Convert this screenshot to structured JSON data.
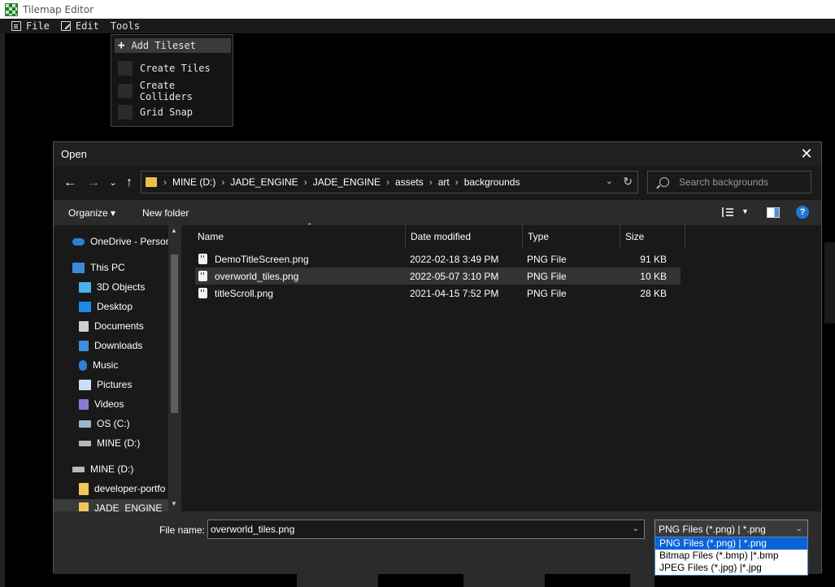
{
  "app": {
    "title": "Tilemap Editor"
  },
  "menubar": {
    "file": "File",
    "edit": "Edit",
    "tools": "Tools"
  },
  "tools_menu": {
    "items": [
      "Add Tileset",
      "Create Tiles",
      "Create Colliders",
      "Grid Snap"
    ],
    "plus_glyph": "+"
  },
  "dialog": {
    "title": "Open",
    "close_glyph": "✕",
    "nav": {
      "back": "←",
      "forward": "→",
      "recent": "⌄",
      "up": "↑"
    },
    "breadcrumb": [
      "MINE (D:)",
      "JADE_ENGINE",
      "JADE_ENGINE",
      "assets",
      "art",
      "backgrounds"
    ],
    "breadcrumb_sep": "›",
    "search_placeholder": "Search backgrounds",
    "toolbar": {
      "organize": "Organize ▾",
      "new_folder": "New folder",
      "help": "?"
    },
    "nav_pane": [
      {
        "label": "OneDrive - Person",
        "icon": "cloud-icon",
        "color": "#2f7fd6"
      },
      {
        "label": "This PC",
        "icon": "computer-icon",
        "color": "#3a8ad9"
      },
      {
        "label": "3D Objects",
        "icon": "cube-icon",
        "color": "#49b3e8"
      },
      {
        "label": "Desktop",
        "icon": "desktop-icon",
        "color": "#1e88e5"
      },
      {
        "label": "Documents",
        "icon": "documents-icon",
        "color": "#d0d0d0"
      },
      {
        "label": "Downloads",
        "icon": "download-icon",
        "color": "#3d8fe0"
      },
      {
        "label": "Music",
        "icon": "music-icon",
        "color": "#2f80d8"
      },
      {
        "label": "Pictures",
        "icon": "pictures-icon",
        "color": "#c9dff5"
      },
      {
        "label": "Videos",
        "icon": "videos-icon",
        "color": "#8a7bd6"
      },
      {
        "label": "OS (C:)",
        "icon": "drive-c-icon",
        "color": "#9fb6c9"
      },
      {
        "label": "MINE (D:)",
        "icon": "drive-d-icon",
        "color": "#b8b8b8"
      },
      {
        "label": "MINE (D:)",
        "icon": "drive-d-icon",
        "color": "#b8b8b8"
      },
      {
        "label": "developer-portfo",
        "icon": "folder-icon",
        "color": "#f0c75a"
      },
      {
        "label": "JADE_ENGINE",
        "icon": "folder-icon",
        "color": "#f0c75a"
      }
    ],
    "columns": [
      "Name",
      "Date modified",
      "Type",
      "Size"
    ],
    "files": [
      {
        "name": "DemoTitleScreen.png",
        "date": "2022-02-18 3:49 PM",
        "type": "PNG File",
        "size": "91 KB"
      },
      {
        "name": "overworld_tiles.png",
        "date": "2022-05-07 3:10 PM",
        "type": "PNG File",
        "size": "10 KB"
      },
      {
        "name": "titleScroll.png",
        "date": "2021-04-15 7:52 PM",
        "type": "PNG File",
        "size": "28 KB"
      }
    ],
    "selected_file_index": 1,
    "file_name_label": "File name:",
    "file_name_value": "overworld_tiles.png",
    "file_type_value": "PNG Files (*.png) | *.png",
    "file_type_options": [
      "PNG Files (*.png) | *.png",
      "Bitmap Files (*.bmp) |*.bmp",
      "JPEG Files (*.jpg) |*.jpg"
    ]
  }
}
